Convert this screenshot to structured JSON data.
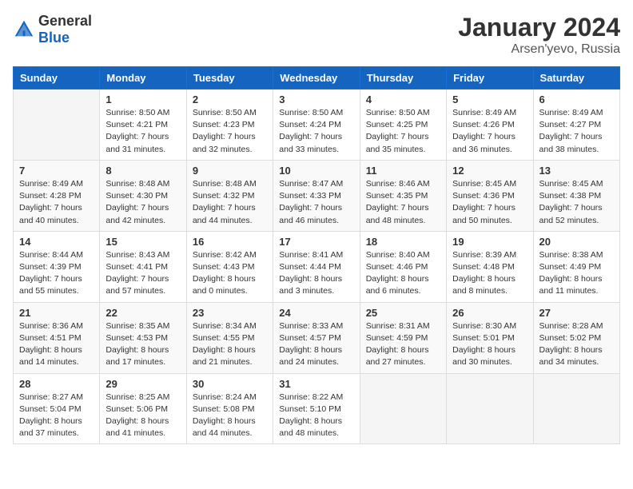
{
  "logo": {
    "general": "General",
    "blue": "Blue"
  },
  "title": "January 2024",
  "subtitle": "Arsen'yevo, Russia",
  "weekdays": [
    "Sunday",
    "Monday",
    "Tuesday",
    "Wednesday",
    "Thursday",
    "Friday",
    "Saturday"
  ],
  "weeks": [
    [
      {
        "day": "",
        "info": ""
      },
      {
        "day": "1",
        "info": "Sunrise: 8:50 AM\nSunset: 4:21 PM\nDaylight: 7 hours\nand 31 minutes."
      },
      {
        "day": "2",
        "info": "Sunrise: 8:50 AM\nSunset: 4:23 PM\nDaylight: 7 hours\nand 32 minutes."
      },
      {
        "day": "3",
        "info": "Sunrise: 8:50 AM\nSunset: 4:24 PM\nDaylight: 7 hours\nand 33 minutes."
      },
      {
        "day": "4",
        "info": "Sunrise: 8:50 AM\nSunset: 4:25 PM\nDaylight: 7 hours\nand 35 minutes."
      },
      {
        "day": "5",
        "info": "Sunrise: 8:49 AM\nSunset: 4:26 PM\nDaylight: 7 hours\nand 36 minutes."
      },
      {
        "day": "6",
        "info": "Sunrise: 8:49 AM\nSunset: 4:27 PM\nDaylight: 7 hours\nand 38 minutes."
      }
    ],
    [
      {
        "day": "7",
        "info": "Sunrise: 8:49 AM\nSunset: 4:28 PM\nDaylight: 7 hours\nand 40 minutes."
      },
      {
        "day": "8",
        "info": "Sunrise: 8:48 AM\nSunset: 4:30 PM\nDaylight: 7 hours\nand 42 minutes."
      },
      {
        "day": "9",
        "info": "Sunrise: 8:48 AM\nSunset: 4:32 PM\nDaylight: 7 hours\nand 44 minutes."
      },
      {
        "day": "10",
        "info": "Sunrise: 8:47 AM\nSunset: 4:33 PM\nDaylight: 7 hours\nand 46 minutes."
      },
      {
        "day": "11",
        "info": "Sunrise: 8:46 AM\nSunset: 4:35 PM\nDaylight: 7 hours\nand 48 minutes."
      },
      {
        "day": "12",
        "info": "Sunrise: 8:45 AM\nSunset: 4:36 PM\nDaylight: 7 hours\nand 50 minutes."
      },
      {
        "day": "13",
        "info": "Sunrise: 8:45 AM\nSunset: 4:38 PM\nDaylight: 7 hours\nand 52 minutes."
      }
    ],
    [
      {
        "day": "14",
        "info": "Sunrise: 8:44 AM\nSunset: 4:39 PM\nDaylight: 7 hours\nand 55 minutes."
      },
      {
        "day": "15",
        "info": "Sunrise: 8:43 AM\nSunset: 4:41 PM\nDaylight: 7 hours\nand 57 minutes."
      },
      {
        "day": "16",
        "info": "Sunrise: 8:42 AM\nSunset: 4:43 PM\nDaylight: 8 hours\nand 0 minutes."
      },
      {
        "day": "17",
        "info": "Sunrise: 8:41 AM\nSunset: 4:44 PM\nDaylight: 8 hours\nand 3 minutes."
      },
      {
        "day": "18",
        "info": "Sunrise: 8:40 AM\nSunset: 4:46 PM\nDaylight: 8 hours\nand 6 minutes."
      },
      {
        "day": "19",
        "info": "Sunrise: 8:39 AM\nSunset: 4:48 PM\nDaylight: 8 hours\nand 8 minutes."
      },
      {
        "day": "20",
        "info": "Sunrise: 8:38 AM\nSunset: 4:49 PM\nDaylight: 8 hours\nand 11 minutes."
      }
    ],
    [
      {
        "day": "21",
        "info": "Sunrise: 8:36 AM\nSunset: 4:51 PM\nDaylight: 8 hours\nand 14 minutes."
      },
      {
        "day": "22",
        "info": "Sunrise: 8:35 AM\nSunset: 4:53 PM\nDaylight: 8 hours\nand 17 minutes."
      },
      {
        "day": "23",
        "info": "Sunrise: 8:34 AM\nSunset: 4:55 PM\nDaylight: 8 hours\nand 21 minutes."
      },
      {
        "day": "24",
        "info": "Sunrise: 8:33 AM\nSunset: 4:57 PM\nDaylight: 8 hours\nand 24 minutes."
      },
      {
        "day": "25",
        "info": "Sunrise: 8:31 AM\nSunset: 4:59 PM\nDaylight: 8 hours\nand 27 minutes."
      },
      {
        "day": "26",
        "info": "Sunrise: 8:30 AM\nSunset: 5:01 PM\nDaylight: 8 hours\nand 30 minutes."
      },
      {
        "day": "27",
        "info": "Sunrise: 8:28 AM\nSunset: 5:02 PM\nDaylight: 8 hours\nand 34 minutes."
      }
    ],
    [
      {
        "day": "28",
        "info": "Sunrise: 8:27 AM\nSunset: 5:04 PM\nDaylight: 8 hours\nand 37 minutes."
      },
      {
        "day": "29",
        "info": "Sunrise: 8:25 AM\nSunset: 5:06 PM\nDaylight: 8 hours\nand 41 minutes."
      },
      {
        "day": "30",
        "info": "Sunrise: 8:24 AM\nSunset: 5:08 PM\nDaylight: 8 hours\nand 44 minutes."
      },
      {
        "day": "31",
        "info": "Sunrise: 8:22 AM\nSunset: 5:10 PM\nDaylight: 8 hours\nand 48 minutes."
      },
      {
        "day": "",
        "info": ""
      },
      {
        "day": "",
        "info": ""
      },
      {
        "day": "",
        "info": ""
      }
    ]
  ]
}
